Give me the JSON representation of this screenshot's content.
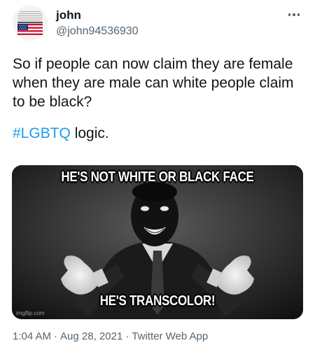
{
  "tweet": {
    "display_name": "john",
    "handle": "@john94536930",
    "avatar_icon": "us-flag-avatar-icon",
    "more_icon": "more-options-icon",
    "text_line": "So if people can now claim they are female when they are male can white people claim to be black?",
    "hashtag": "#LGBTQ",
    "hashtag_suffix": " logic.",
    "media": {
      "top_caption": "HE'S NOT WHITE OR BLACK FACE",
      "bottom_caption": "HE'S TRANSCOLOR!",
      "watermark": "imgflip.com"
    },
    "time": "1:04 AM",
    "date": "Aug 28, 2021",
    "source": "Twitter Web App",
    "separator": "·"
  },
  "colors": {
    "text": "#0f1419",
    "secondary": "#536471",
    "link": "#1d9bf0",
    "background": "#ffffff"
  }
}
